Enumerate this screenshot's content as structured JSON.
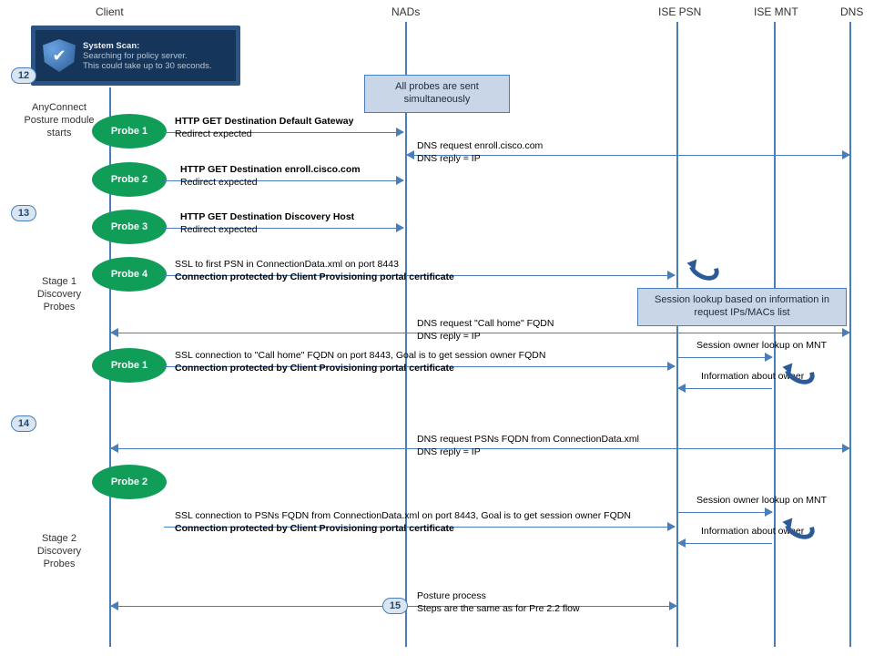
{
  "columns": {
    "client": "Client",
    "nads": "NADs",
    "ise_psn": "ISE PSN",
    "ise_mnt": "ISE MNT",
    "dns": "DNS"
  },
  "scanbox": {
    "title": "System Scan:",
    "l1": "Searching for policy server.",
    "l2": "This could take up to 30 seconds."
  },
  "steps": {
    "s12": "12",
    "s13": "13",
    "s14": "14",
    "s15": "15"
  },
  "side": {
    "start": "AnyConnect\nPosture module\nstarts",
    "stage1": "Stage 1\nDiscovery\nProbes",
    "stage2": "Stage 2\nDiscovery\nProbes"
  },
  "probes": {
    "p1": {
      "name": "Probe 1",
      "l1": "HTTP GET Destination Default Gateway",
      "l2": "Redirect expected"
    },
    "p2": {
      "name": "Probe 2",
      "l1": "HTTP GET Destination enroll.cisco.com",
      "l2": "Redirect expected",
      "dns1": "DNS request enroll.cisco.com",
      "dns2": "DNS reply = IP"
    },
    "p3": {
      "name": "Probe 3",
      "l1": "HTTP GET Destination Discovery Host",
      "l2": "Redirect expected"
    },
    "p4": {
      "name": "Probe 4",
      "l1": "SSL to first  PSN  in ConnectionData.xml on port 8443",
      "l2": "Connection  protected by Client Provisioning  portal certificate"
    }
  },
  "infobox": {
    "simul": "All probes are sent simultaneously",
    "lookup": "Session lookup based on information in request IPs/MACs list"
  },
  "stage2": {
    "dns_req": "DNS request \"Call home\" FQDN",
    "dns_rep": "DNS reply = IP",
    "p1": {
      "name": "Probe 1",
      "l1": "SSL connection to \"Call home\" FQDN on port 8443, Goal is to get  session owner FQDN",
      "l2": "Connection  protected by Client Provisioning  portal certificate"
    },
    "mnt1": "Session owner lookup on MNT",
    "mnt2": "Information about owner",
    "dns_req2": "DNS request PSNs FQDN from ConnectionData.xml",
    "dns_rep2": "DNS reply = IP",
    "p2": {
      "name": "Probe 2",
      "l1": "SSL connection to PSNs FQDN from ConnectionData.xml on port 8443, Goal is to get  session owner FQDN",
      "l2": "Connection  protected by Client Provisioning  portal certificate"
    }
  },
  "posture": {
    "l1": "Posture process",
    "l2": "Steps are the same as for Pre 2.2 flow"
  }
}
